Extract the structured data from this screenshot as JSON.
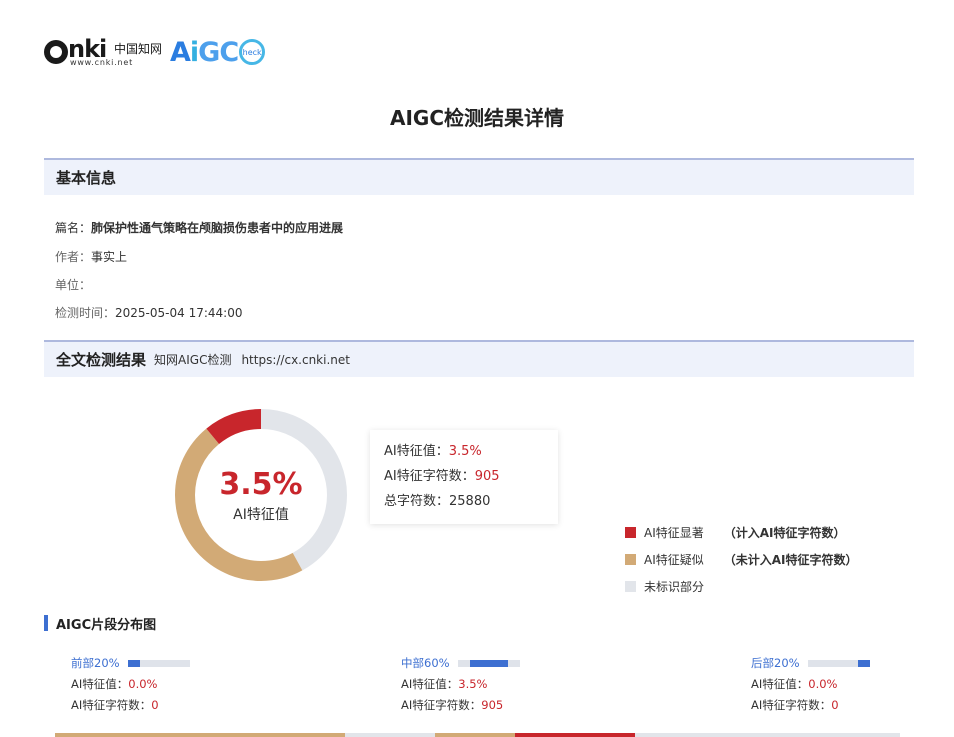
{
  "logo": {
    "cnki_word": "nki",
    "cnki_cn": "中国知网",
    "cnki_url": "www.cnki.net",
    "aigc_a": "A",
    "aigc_i": "i",
    "aigc_gc": "GC",
    "check": "heck"
  },
  "title": "AIGC检测结果详情",
  "basic": {
    "heading": "基本信息",
    "article_label": "篇名：",
    "article_value": "肺保护性通气策略在颅脑损伤患者中的应用进展",
    "author_label": "作者：",
    "author_value": "事实上",
    "unit_label": "单位：",
    "unit_value": "",
    "time_label": "检测时间：",
    "time_value": "2025-05-04 17:44:00"
  },
  "result": {
    "heading": "全文检测结果",
    "sub": "知网AIGC检测",
    "url": "https://cx.cnki.net"
  },
  "donut": {
    "percent": "3.5%",
    "label": "AI特征值",
    "red_fraction": 0.11,
    "tan_fraction": 0.47,
    "gray_fraction": 0.42
  },
  "stats": {
    "ai_value_label": "AI特征值：",
    "ai_value": "3.5%",
    "ai_chars_label": "AI特征字符数：",
    "ai_chars": "905",
    "total_label": "总字符数：",
    "total": "25880"
  },
  "legend": [
    {
      "label": "AI特征显著",
      "note": "（计入AI特征字符数）",
      "color": "#c8262c"
    },
    {
      "label": "AI特征疑似",
      "note": "（未计入AI特征字符数）",
      "color": "#d2aa76"
    },
    {
      "label": "未标识部分",
      "note": "",
      "color": "#e2e5ea"
    }
  ],
  "distribution": {
    "heading": "AIGC片段分布图",
    "segments": [
      {
        "name": "前部20%",
        "ai_label": "AI特征值：",
        "ai_value": "0.0%",
        "chars_label": "AI特征字符数：",
        "chars_value": "0"
      },
      {
        "name": "中部60%",
        "ai_label": "AI特征值：",
        "ai_value": "3.5%",
        "chars_label": "AI特征字符数：",
        "chars_value": "905"
      },
      {
        "name": "后部20%",
        "ai_label": "AI特征值：",
        "ai_value": "0.0%",
        "chars_label": "AI特征字符数：",
        "chars_value": "0"
      }
    ]
  },
  "colors": {
    "accent_blue": "#3d6fd1",
    "ai_red": "#c8262c",
    "ai_tan": "#d2aa76",
    "unmarked_gray": "#e2e5ea"
  }
}
